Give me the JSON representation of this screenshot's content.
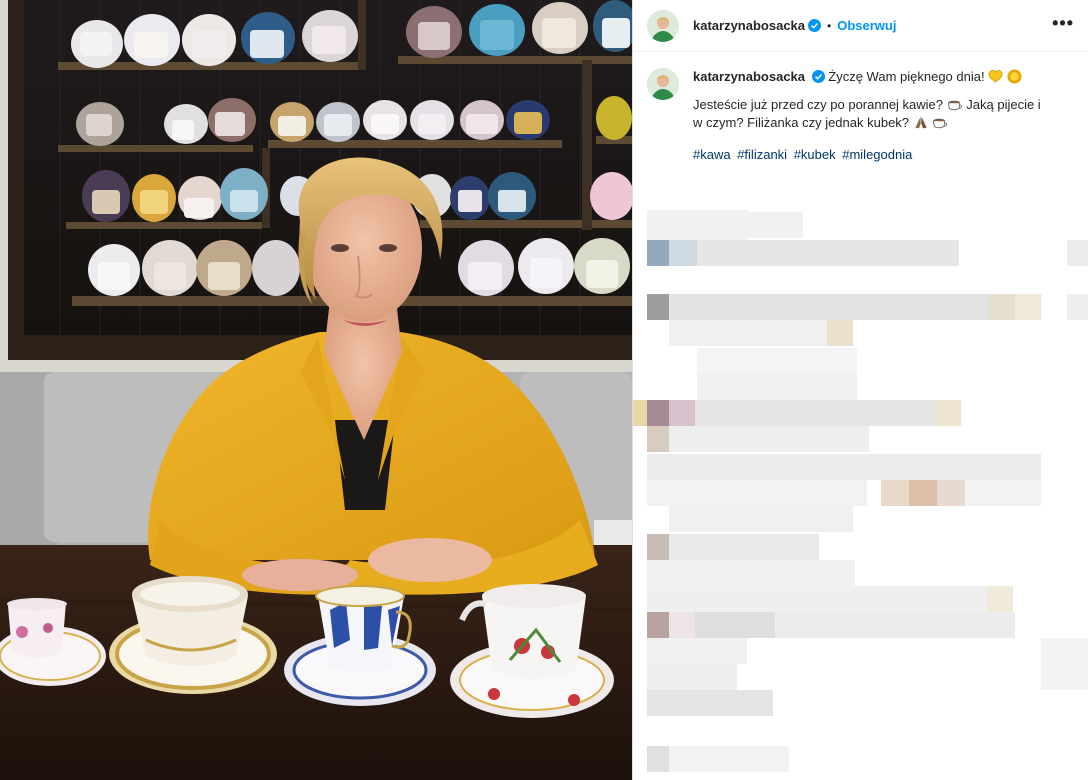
{
  "post": {
    "username": "katarzynabosacka",
    "follow_label": "Obserwuj",
    "more_label": "•••",
    "dot": "•"
  },
  "caption": {
    "greeting": " Życzę Wam pięknego dnia! ",
    "line1": "Jesteście już przed czy po porannej kawie? ",
    "line2": " Jaką pijecie i w czym? Filiżanka czy jednak kubek? ",
    "hashtags": [
      "#kawa",
      "#filizanki",
      "#kubek",
      "#milegodnia"
    ]
  },
  "icons": {
    "verified": "verified-badge-icon",
    "heart": "yellow-heart-icon",
    "sun": "sun-icon",
    "coffee": "coffee-cup-icon",
    "pray": "folded-hands-icon",
    "more": "more-options-icon"
  },
  "colors": {
    "link": "#0095f6",
    "hashtag": "#00376b",
    "text": "#262626",
    "jacket": "#e8ad1e"
  }
}
